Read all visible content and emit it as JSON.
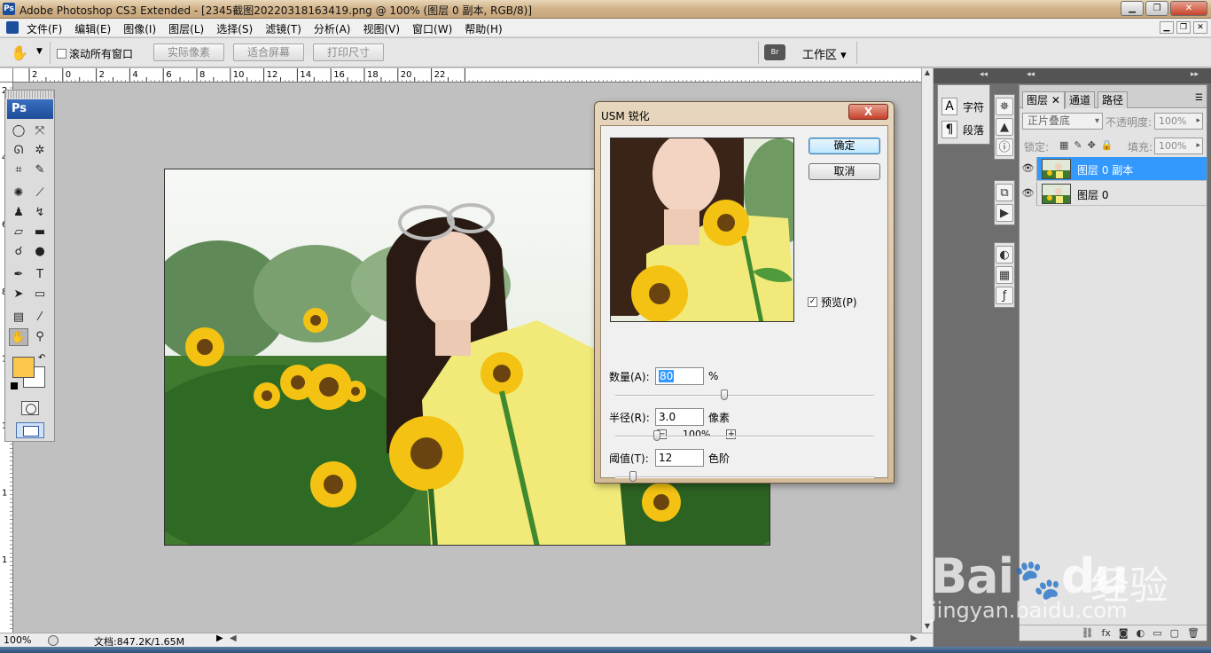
{
  "app": {
    "title": "Adobe Photoshop CS3 Extended - [2345截图20220318163419.png @ 100% (图层 0 副本, RGB/8)]",
    "ps_label": "Ps"
  },
  "menu": [
    "文件(F)",
    "编辑(E)",
    "图像(I)",
    "图层(L)",
    "选择(S)",
    "滤镜(T)",
    "分析(A)",
    "视图(V)",
    "窗口(W)",
    "帮助(H)"
  ],
  "options": {
    "scroll_all_label": "滚动所有窗口",
    "btn_actual": "实际像素",
    "btn_fit": "适合屏幕",
    "btn_print": "打印尺寸",
    "bridge_label": "Br",
    "workspace_label": "工作区 ▾"
  },
  "ruler": {
    "h_ticks": [
      "2",
      "0",
      "2",
      "4",
      "6",
      "8",
      "10",
      "12",
      "14",
      "16",
      "18",
      "20",
      "22"
    ],
    "v_ticks": [
      "2",
      "4",
      "6",
      "8",
      "1",
      "1",
      "1",
      "1"
    ]
  },
  "status": {
    "zoom": "100%",
    "doc_info": "文档:847.2K/1.65M"
  },
  "colors": {
    "foreground": "#fcc54c",
    "background": "#ffffff",
    "selection": "#3399ff"
  },
  "dialog": {
    "title": "USM 锐化",
    "close_label": "X",
    "ok_label": "确定",
    "cancel_label": "取消",
    "preview_label": "预览(P)",
    "preview_checked": true,
    "zoom_level": "100%",
    "amount_label": "数量(A):",
    "amount_value": "80",
    "amount_unit": "%",
    "amount_slider": 0.42,
    "radius_label": "半径(R):",
    "radius_value": "3.0",
    "radius_unit": "像素",
    "radius_slider": 0.16,
    "threshold_label": "阈值(T):",
    "threshold_value": "12",
    "threshold_unit": "色阶",
    "threshold_slider": 0.07
  },
  "char_panel": {
    "char_label": "字符",
    "para_label": "段落"
  },
  "layers_panel": {
    "tabs": [
      "图层",
      "通道",
      "路径"
    ],
    "blend_mode": "正片叠底",
    "opacity_label": "不透明度:",
    "opacity_value": "100%",
    "lock_label": "锁定:",
    "fill_label": "填充:",
    "fill_value": "100%",
    "layers": [
      {
        "name": "图层 0 副本",
        "selected": true
      },
      {
        "name": "图层 0",
        "selected": false
      }
    ]
  },
  "watermark": {
    "brand": "Bai",
    "brand2": "du",
    "cn": "经验",
    "url": "jingyan.baidu.com"
  }
}
